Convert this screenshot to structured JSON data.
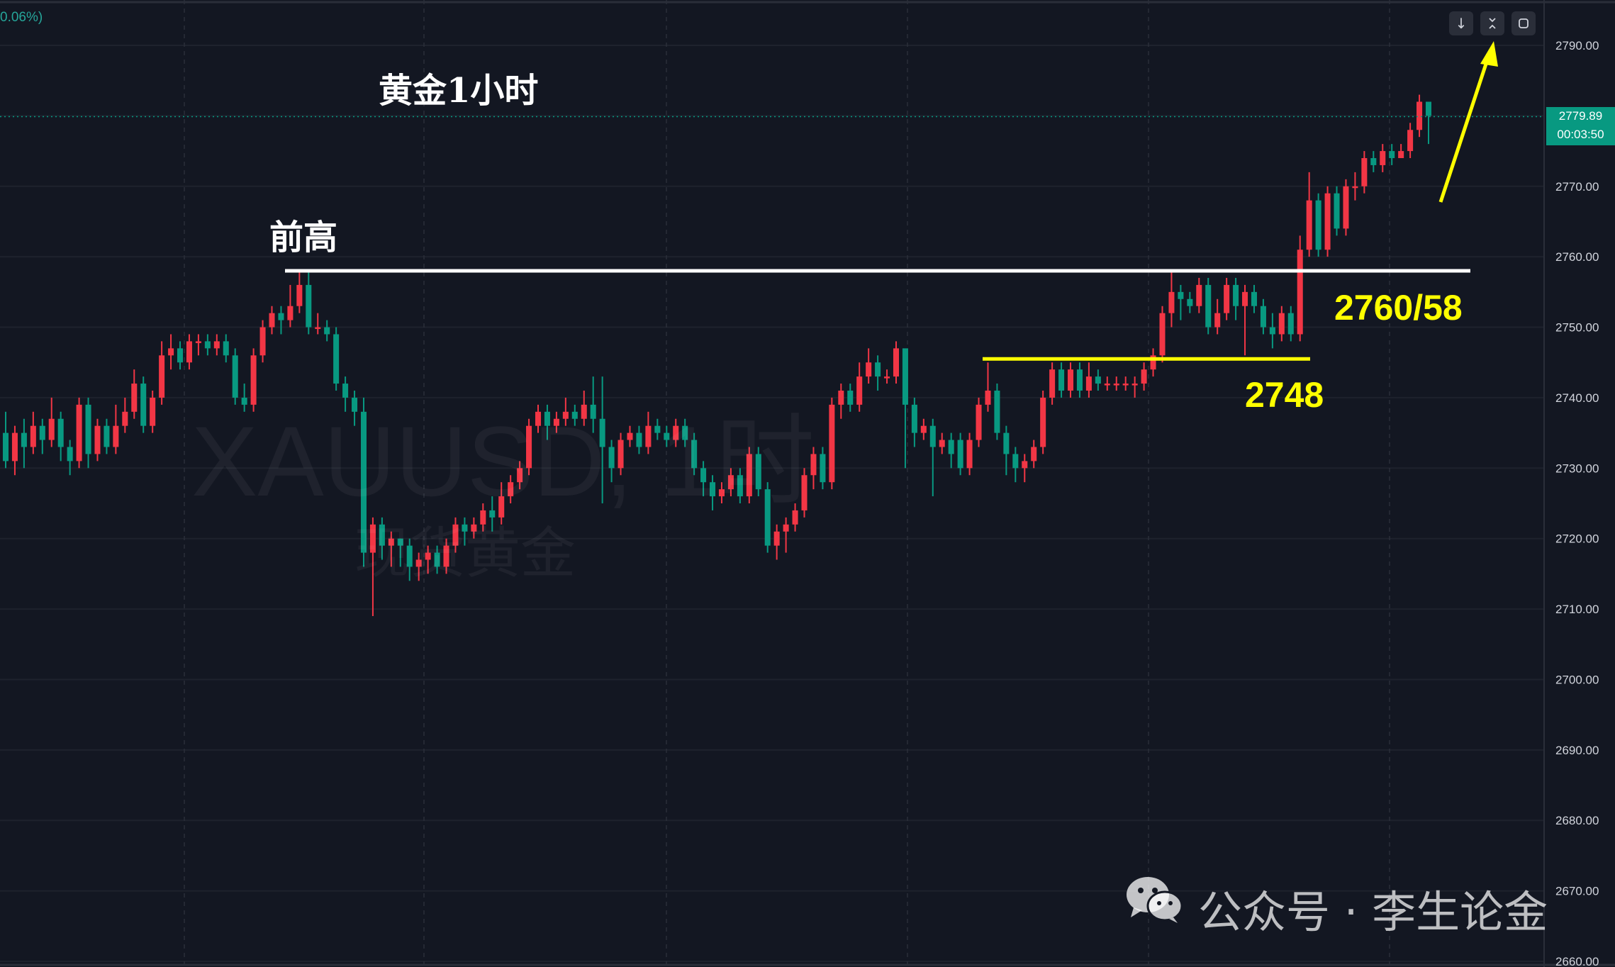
{
  "top_bar": {
    "change_text": "0.06%)"
  },
  "toolbar": {
    "icons": [
      "arrow-down-icon",
      "collapse-icon",
      "fullscreen-icon"
    ]
  },
  "annotations": {
    "title": "黄金1小时",
    "prev_high_label": "前高",
    "level_upper": "2760/58",
    "level_lower": "2748"
  },
  "watermark": {
    "symbol": "XAUUSD, 1时",
    "name": "现货黄金"
  },
  "footer": {
    "brand": "公众号 · 李生论金"
  },
  "price_scale": {
    "last_price": "2779.89",
    "countdown": "00:03:50",
    "ticks": [
      "2790.00",
      "2780.00",
      "2770.00",
      "2760.00",
      "2750.00",
      "2740.00",
      "2730.00",
      "2720.00",
      "2710.00",
      "2700.00",
      "2690.00",
      "2680.00",
      "2670.00",
      "2660.00"
    ]
  },
  "colors": {
    "background": "#131722",
    "up": "#f23645",
    "down": "#089981",
    "annotation_yellow": "#ffff00",
    "resistance_white": "#ffffff",
    "price_box": "#089981"
  },
  "chart_data": {
    "type": "candlestick",
    "symbol": "XAUUSD",
    "timeframe": "1H",
    "ylim": [
      2660,
      2793
    ],
    "grid": true,
    "levels": [
      2758,
      2745.5
    ],
    "candles": [
      [
        2735,
        2731,
        2738,
        2730
      ],
      [
        2731,
        2735,
        2736,
        2729
      ],
      [
        2735,
        2733,
        2737,
        2730
      ],
      [
        2733,
        2736,
        2738,
        2732
      ],
      [
        2736,
        2734,
        2737,
        2732
      ],
      [
        2734,
        2737,
        2740,
        2733
      ],
      [
        2737,
        2733,
        2738,
        2731
      ],
      [
        2733,
        2731,
        2734,
        2729
      ],
      [
        2731,
        2739,
        2740,
        2730
      ],
      [
        2739,
        2732,
        2740,
        2730
      ],
      [
        2732,
        2736,
        2737,
        2731
      ],
      [
        2736,
        2733,
        2737,
        2732
      ],
      [
        2733,
        2736,
        2739,
        2732
      ],
      [
        2736,
        2738,
        2740,
        2735
      ],
      [
        2738,
        2742,
        2744,
        2737
      ],
      [
        2742,
        2736,
        2743,
        2735
      ],
      [
        2736,
        2740,
        2741,
        2735
      ],
      [
        2740,
        2746,
        2748,
        2739
      ],
      [
        2746,
        2747,
        2749,
        2744
      ],
      [
        2747,
        2745,
        2748,
        2744
      ],
      [
        2745,
        2748,
        2749,
        2744
      ],
      [
        2748,
        2748,
        2749,
        2746
      ],
      [
        2748,
        2747,
        2749,
        2746
      ],
      [
        2747,
        2748,
        2749,
        2746
      ],
      [
        2748,
        2746,
        2749,
        2745
      ],
      [
        2746,
        2740,
        2747,
        2739
      ],
      [
        2740,
        2739,
        2742,
        2738
      ],
      [
        2739,
        2746,
        2747,
        2738
      ],
      [
        2746,
        2750,
        2751,
        2745
      ],
      [
        2750,
        2752,
        2753,
        2749
      ],
      [
        2752,
        2751,
        2753,
        2749
      ],
      [
        2751,
        2753,
        2756,
        2750
      ],
      [
        2753,
        2756,
        2758,
        2752
      ],
      [
        2756,
        2750,
        2758,
        2749
      ],
      [
        2750,
        2750,
        2752,
        2749
      ],
      [
        2750,
        2749,
        2751,
        2748
      ],
      [
        2749,
        2742,
        2750,
        2741
      ],
      [
        2742,
        2740,
        2743,
        2738
      ],
      [
        2740,
        2738,
        2741,
        2736
      ],
      [
        2738,
        2718,
        2740,
        2716
      ],
      [
        2718,
        2722,
        2723,
        2709
      ],
      [
        2722,
        2719,
        2723,
        2717
      ],
      [
        2719,
        2720,
        2721,
        2716
      ],
      [
        2720,
        2719,
        2720,
        2716
      ],
      [
        2719,
        2716,
        2720,
        2714
      ],
      [
        2716,
        2717,
        2718,
        2714
      ],
      [
        2717,
        2718,
        2719,
        2715
      ],
      [
        2718,
        2716,
        2719,
        2715
      ],
      [
        2716,
        2719,
        2720,
        2715
      ],
      [
        2719,
        2722,
        2723,
        2718
      ],
      [
        2722,
        2721,
        2723,
        2719
      ],
      [
        2721,
        2722,
        2723,
        2720
      ],
      [
        2722,
        2724,
        2725,
        2721
      ],
      [
        2724,
        2723,
        2726,
        2721
      ],
      [
        2723,
        2726,
        2728,
        2722
      ],
      [
        2726,
        2728,
        2729,
        2725
      ],
      [
        2728,
        2730,
        2731,
        2727
      ],
      [
        2730,
        2736,
        2737,
        2729
      ],
      [
        2736,
        2738,
        2739,
        2735
      ],
      [
        2738,
        2736,
        2739,
        2734
      ],
      [
        2736,
        2737,
        2738,
        2735
      ],
      [
        2737,
        2738,
        2740,
        2736
      ],
      [
        2738,
        2737,
        2739,
        2736
      ],
      [
        2737,
        2739,
        2741,
        2736
      ],
      [
        2739,
        2737,
        2743,
        2735
      ],
      [
        2737,
        2733,
        2743,
        2725
      ],
      [
        2733,
        2730,
        2734,
        2728
      ],
      [
        2730,
        2734,
        2735,
        2729
      ],
      [
        2734,
        2735,
        2736,
        2733
      ],
      [
        2735,
        2733,
        2736,
        2732
      ],
      [
        2733,
        2736,
        2738,
        2732
      ],
      [
        2736,
        2735,
        2737,
        2734
      ],
      [
        2735,
        2734,
        2736,
        2733
      ],
      [
        2734,
        2736,
        2737,
        2733
      ],
      [
        2736,
        2734,
        2737,
        2733
      ],
      [
        2734,
        2730,
        2735,
        2729
      ],
      [
        2730,
        2728,
        2731,
        2726
      ],
      [
        2728,
        2726,
        2729,
        2724
      ],
      [
        2726,
        2727,
        2728,
        2725
      ],
      [
        2727,
        2729,
        2730,
        2726
      ],
      [
        2729,
        2726,
        2730,
        2725
      ],
      [
        2726,
        2732,
        2733,
        2725
      ],
      [
        2732,
        2727,
        2733,
        2726
      ],
      [
        2727,
        2719,
        2728,
        2718
      ],
      [
        2719,
        2721,
        2722,
        2717
      ],
      [
        2721,
        2722,
        2723,
        2718
      ],
      [
        2722,
        2724,
        2725,
        2721
      ],
      [
        2724,
        2729,
        2730,
        2723
      ],
      [
        2729,
        2732,
        2733,
        2727
      ],
      [
        2732,
        2728,
        2733,
        2727
      ],
      [
        2728,
        2739,
        2740,
        2727
      ],
      [
        2739,
        2741,
        2742,
        2737
      ],
      [
        2741,
        2739,
        2742,
        2738
      ],
      [
        2739,
        2743,
        2745,
        2738
      ],
      [
        2743,
        2745,
        2747,
        2742
      ],
      [
        2745,
        2743,
        2746,
        2741
      ],
      [
        2743,
        2743,
        2744,
        2742
      ],
      [
        2743,
        2747,
        2748,
        2742
      ],
      [
        2747,
        2739,
        2740,
        2730
      ],
      [
        2739,
        2735,
        2740,
        2733
      ],
      [
        2735,
        2736,
        2737,
        2734
      ],
      [
        2736,
        2733,
        2737,
        2726
      ],
      [
        2733,
        2734,
        2735,
        2732
      ],
      [
        2734,
        2732,
        2735,
        2730
      ],
      [
        2734,
        2730,
        2735,
        2729
      ],
      [
        2730,
        2734,
        2735,
        2729
      ],
      [
        2734,
        2739,
        2740,
        2733
      ],
      [
        2739,
        2741,
        2745,
        2738
      ],
      [
        2741,
        2735,
        2742,
        2734
      ],
      [
        2735,
        2732,
        2736,
        2729
      ],
      [
        2732,
        2730,
        2733,
        2728
      ],
      [
        2730,
        2731,
        2732,
        2728
      ],
      [
        2731,
        2733,
        2734,
        2730
      ],
      [
        2733,
        2740,
        2741,
        2732
      ],
      [
        2740,
        2744,
        2745,
        2739
      ],
      [
        2744,
        2741,
        2745,
        2740
      ],
      [
        2741,
        2744,
        2745,
        2740
      ],
      [
        2744,
        2741,
        2745,
        2740
      ],
      [
        2741,
        2743,
        2745,
        2740
      ],
      [
        2743,
        2742,
        2744,
        2741
      ],
      [
        2742,
        2742,
        2743,
        2741
      ],
      [
        2742,
        2742,
        2743,
        2741
      ],
      [
        2742,
        2742,
        2743,
        2741
      ],
      [
        2742,
        2742,
        2743,
        2740
      ],
      [
        2742,
        2744,
        2745,
        2741
      ],
      [
        2744,
        2746,
        2747,
        2743
      ],
      [
        2746,
        2752,
        2753,
        2745
      ],
      [
        2752,
        2755,
        2758,
        2750
      ],
      [
        2755,
        2754,
        2756,
        2751
      ],
      [
        2754,
        2753,
        2755,
        2752
      ],
      [
        2753,
        2756,
        2757,
        2752
      ],
      [
        2756,
        2750,
        2757,
        2749
      ],
      [
        2750,
        2752,
        2754,
        2749
      ],
      [
        2752,
        2756,
        2757,
        2751
      ],
      [
        2756,
        2753,
        2757,
        2751
      ],
      [
        2753,
        2755,
        2756,
        2746
      ],
      [
        2755,
        2753,
        2756,
        2752
      ],
      [
        2753,
        2750,
        2754,
        2749
      ],
      [
        2750,
        2749,
        2752,
        2747
      ],
      [
        2749,
        2752,
        2753,
        2748
      ],
      [
        2752,
        2749,
        2753,
        2748
      ],
      [
        2749,
        2761,
        2763,
        2748
      ],
      [
        2761,
        2768,
        2772,
        2760
      ],
      [
        2768,
        2761,
        2769,
        2760
      ],
      [
        2761,
        2769,
        2770,
        2760
      ],
      [
        2769,
        2764,
        2770,
        2763
      ],
      [
        2764,
        2770,
        2771,
        2763
      ],
      [
        2770,
        2770,
        2772,
        2768
      ],
      [
        2770,
        2774,
        2775,
        2769
      ],
      [
        2774,
        2773,
        2775,
        2772
      ],
      [
        2773,
        2775,
        2776,
        2772
      ],
      [
        2775,
        2774,
        2776,
        2773
      ],
      [
        2774,
        2775,
        2776,
        2774
      ],
      [
        2775,
        2778,
        2779,
        2774
      ],
      [
        2778,
        2782,
        2783,
        2777
      ],
      [
        2782,
        2780,
        2782,
        2776
      ]
    ]
  }
}
